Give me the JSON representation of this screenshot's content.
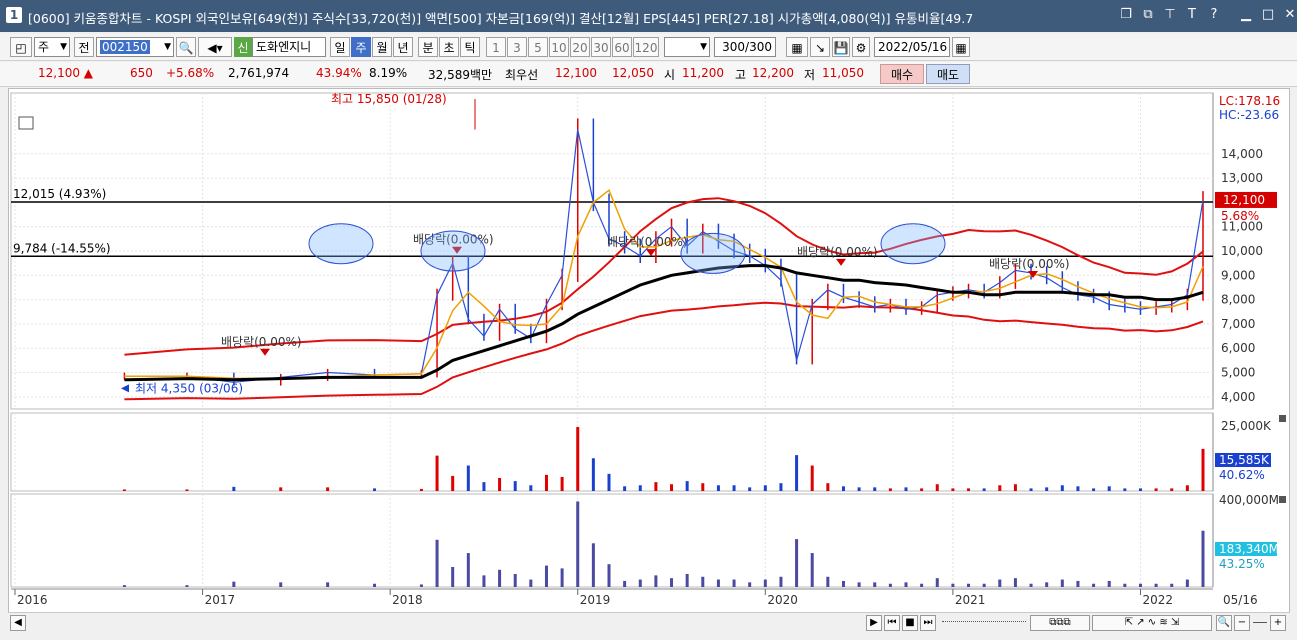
{
  "window": {
    "number": "1",
    "title": "[0600] 키움종합차트 - KOSPI 외국인보유[649(천)] 주식수[33,720(천)] 액면[500] 자본금[169(억)] 결산[12월] EPS[445] PER[27.18] 시가총액[4,080(억)] 유통비율[49.7",
    "icons": [
      "restore-icon",
      "copy-icon",
      "pin-icon",
      "font-icon",
      "help-icon",
      "minimize-icon",
      "maximize-icon",
      "close-icon"
    ]
  },
  "toolbar": {
    "period_select": "주",
    "prev_label": "전",
    "code_value": "002150",
    "shin_label": "신",
    "stock_name": "도화엔지니",
    "periods": [
      "일",
      "주",
      "월",
      "년",
      "분",
      "초",
      "틱"
    ],
    "selected_period": "주",
    "intervals": [
      "1",
      "3",
      "5",
      "10",
      "20",
      "30",
      "60",
      "120"
    ],
    "count_value": "300",
    "count_total": "/300",
    "date_value": "2022/05/16"
  },
  "quote": {
    "price": "12,100 ▲",
    "change": "650",
    "change_pct": "+5.68%",
    "volume": "2,761,974",
    "ratio1": "43.94%",
    "ratio2": "8.19%",
    "amount": "32,589백만",
    "preferred_label": "최우선",
    "ask": "12,100",
    "bid": "12,050",
    "open_label": "시",
    "open": "11,200",
    "high_label": "고",
    "high": "12,200",
    "low_label": "저",
    "low": "11,050",
    "buy_label": "매수",
    "sell_label": "매도"
  },
  "colors": {
    "up": "#e00000",
    "down": "#1a40d0",
    "ma_black": "#000000",
    "band": "#e01010",
    "accent": "#2060e0"
  },
  "chart_data": [
    {
      "type": "line",
      "title": "",
      "x": [
        "2016-08",
        "2016-12",
        "2017-03",
        "2017-06",
        "2017-09",
        "2017-12",
        "2018-03",
        "2018-04",
        "2018-05",
        "2018-06",
        "2018-07",
        "2018-08",
        "2018-09",
        "2018-10",
        "2018-11",
        "2018-12",
        "2019-01",
        "2019-02",
        "2019-03",
        "2019-04",
        "2019-05",
        "2019-06",
        "2019-07",
        "2019-08",
        "2019-09",
        "2019-10",
        "2019-11",
        "2019-12",
        "2020-01",
        "2020-02",
        "2020-03",
        "2020-04",
        "2020-05",
        "2020-06",
        "2020-07",
        "2020-08",
        "2020-09",
        "2020-10",
        "2020-11",
        "2020-12",
        "2021-01",
        "2021-02",
        "2021-03",
        "2021-04",
        "2021-05",
        "2021-06",
        "2021-07",
        "2021-08",
        "2021-09",
        "2021-10",
        "2021-11",
        "2021-12",
        "2022-01",
        "2022-02",
        "2022-03",
        "2022-04",
        "2022-05"
      ],
      "series": [
        {
          "values": [
            4850,
            4850,
            4600,
            4800,
            5000,
            4900,
            4950,
            8200,
            9500,
            7200,
            6500,
            7600,
            6800,
            6400,
            7800,
            9000,
            15000,
            12000,
            10500,
            10200,
            9800,
            10500,
            11000,
            10200,
            10800,
            10400,
            10000,
            9800,
            9400,
            8800,
            5500,
            7800,
            8400,
            8100,
            7900,
            7700,
            7800,
            7600,
            7700,
            8200,
            8300,
            8400,
            8300,
            8700,
            9200,
            9100,
            8900,
            8500,
            8200,
            8100,
            7800,
            7700,
            7600,
            7700,
            7800,
            8200,
            12100
          ]
        },
        {
          "values": [
            4700,
            4750,
            4700,
            4750,
            4800,
            4800,
            4800,
            5100,
            5500,
            5700,
            5900,
            6100,
            6300,
            6500,
            6700,
            7000,
            7400,
            7700,
            8000,
            8300,
            8600,
            8800,
            9000,
            9100,
            9200,
            9300,
            9350,
            9400,
            9400,
            9300,
            9100,
            9000,
            8900,
            8800,
            8800,
            8700,
            8650,
            8600,
            8500,
            8400,
            8300,
            8300,
            8200,
            8200,
            8300,
            8300,
            8300,
            8300,
            8250,
            8200,
            8200,
            8100,
            8100,
            8000,
            8000,
            8100,
            8300
          ]
        }
      ],
      "ylim": [
        3500,
        16500
      ],
      "y_ticks": [
        "4,000",
        "5,000",
        "6,000",
        "7,000",
        "8,000",
        "9,000",
        "10,000",
        "11,000",
        "12,000",
        "13,000",
        "14,000"
      ],
      "right_labels": {
        "lc": "LC:178.16",
        "hc": "HC:-23.66",
        "last": "12,100",
        "last_pct": "5.68%"
      },
      "hlines": [
        {
          "label": "12,015 (4.93%)",
          "value": 12015
        },
        {
          "label": "9,784 (-14.55%)",
          "value": 9784
        }
      ],
      "annotations": [
        {
          "text": "최고 15,850 (01/28)",
          "color": "#d40000"
        },
        {
          "text": "최저 4,350 (03/06)",
          "color": "#1a40d0"
        },
        {
          "text": "배당락(0.00%)"
        },
        {
          "text": "배당락(0.00%)"
        },
        {
          "text": "배당락(0.00%)"
        },
        {
          "text": "배당락(0.00%)"
        },
        {
          "text": "배당락(0.00%)"
        }
      ]
    },
    {
      "type": "bar",
      "title": "",
      "ylim": [
        0,
        30000
      ],
      "y_ticks": [
        "25,000K"
      ],
      "right_labels": {
        "value": "15,585K",
        "pct": "40.62%"
      }
    },
    {
      "type": "bar",
      "title": "",
      "ylim": [
        0,
        400000
      ],
      "y_ticks": [
        "400,000M"
      ],
      "right_labels": {
        "value": "183,340M",
        "pct": "43.25%"
      }
    }
  ],
  "x_axis_labels": [
    "2016",
    "2017",
    "2018",
    "2019",
    "2020",
    "2021",
    "2022",
    "05/16"
  ]
}
